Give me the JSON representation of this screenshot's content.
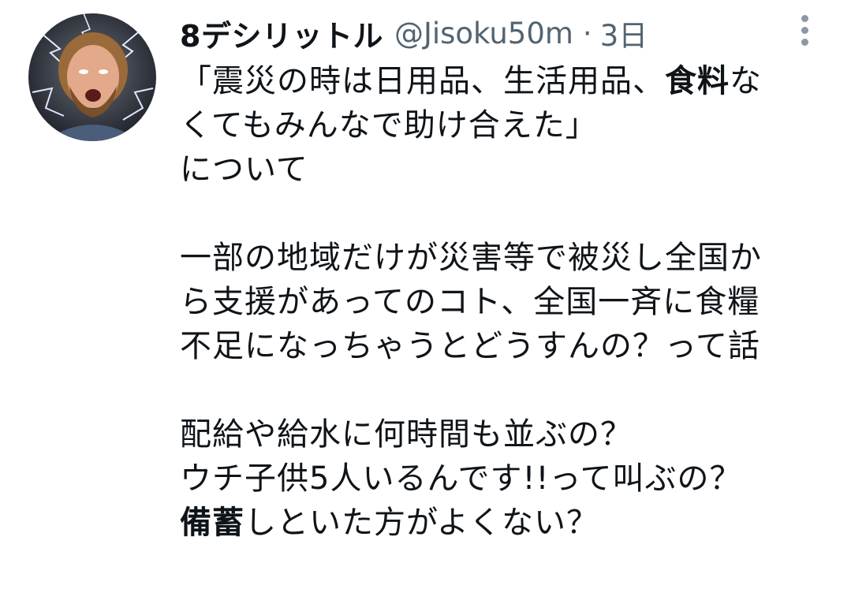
{
  "tweet": {
    "display_name": "8デシリットル",
    "handle": "@Jisoku50m",
    "separator": "·",
    "time": "3日",
    "more_icon": "more-vertical-icon",
    "avatar_icon": "user-avatar-lightning",
    "body": {
      "l1_a": "「震災の時は日用品、生活用品、",
      "l1_b": "食料",
      "l1_c": "な",
      "l2": "くてもみんなで助け合えた」",
      "l3": "について",
      "l4": "一部の地域だけが災害等で被災し全国か",
      "l5": "ら支援があってのコト、全国一斉に食糧",
      "l6": "不足になっちゃうとどうすんの？って話",
      "l7": "配給や給水に何時間も並ぶの？",
      "l8": "ウチ子供5人いるんです!!って叫ぶの？",
      "l9_a": "備蓄",
      "l9_b": "しといた方がよくない？"
    }
  },
  "colors": {
    "text": "#0f1419",
    "secondary": "#536471",
    "icon": "#8b98a5",
    "background": "#ffffff"
  }
}
